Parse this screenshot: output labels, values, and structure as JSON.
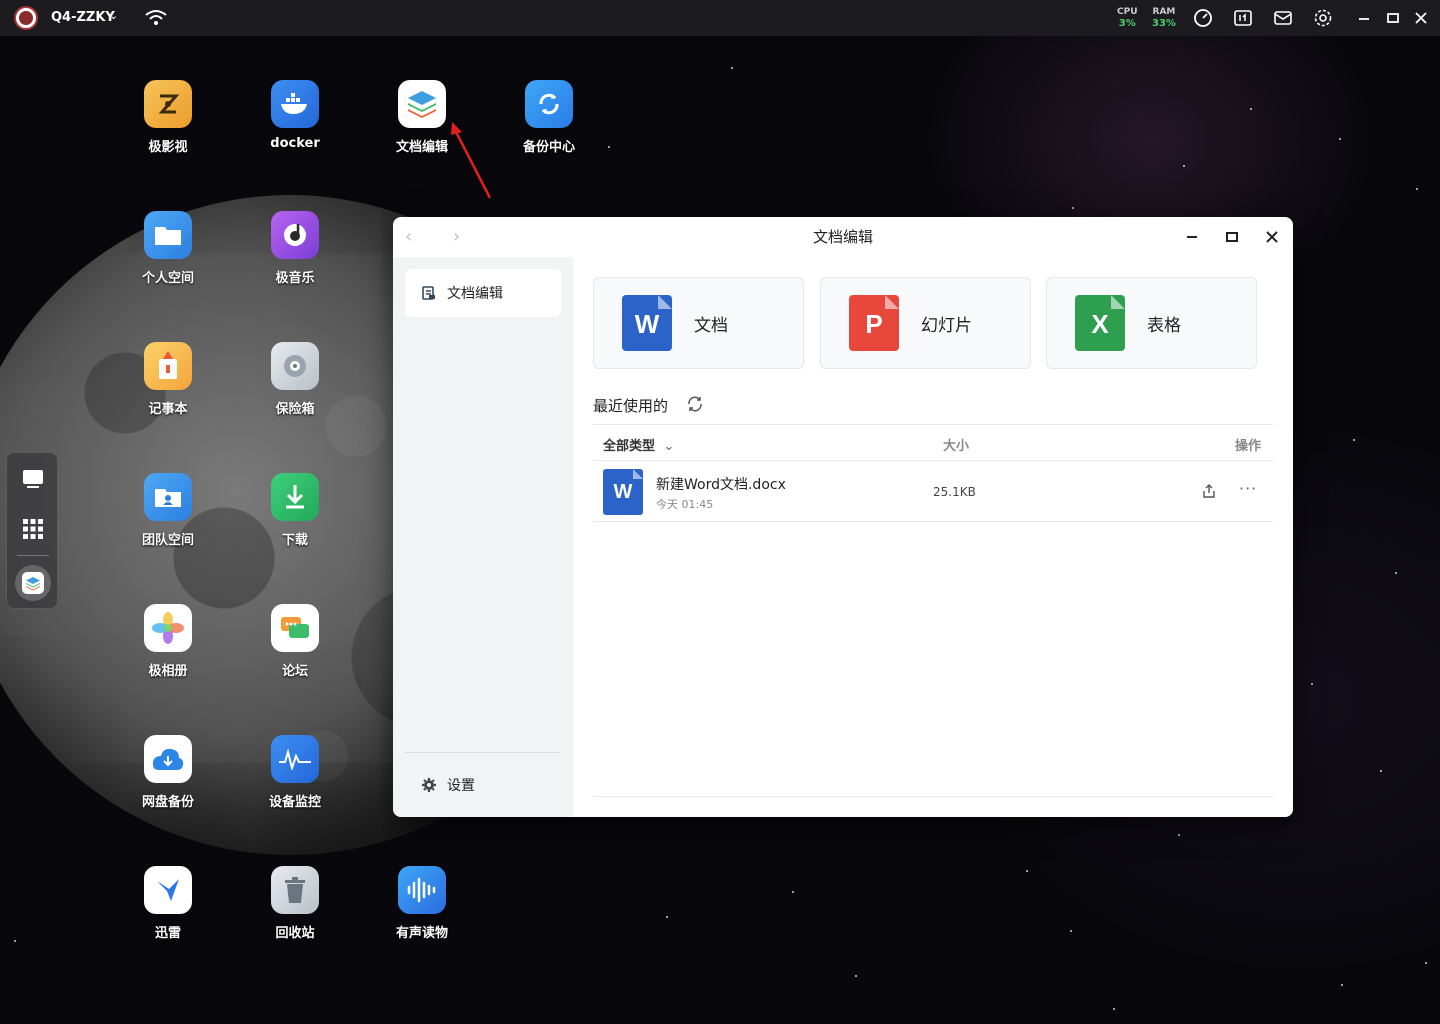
{
  "topbar": {
    "device_name": "Q4-ZZKY",
    "cpu_label": "CPU",
    "cpu_value": "3%",
    "ram_label": "RAM",
    "ram_value": "33%"
  },
  "desktop_icons": [
    {
      "label": "极影视",
      "icon": "film-icon"
    },
    {
      "label": "docker",
      "icon": "docker-icon"
    },
    {
      "label": "文档编辑",
      "icon": "layers-icon"
    },
    {
      "label": "备份中心",
      "icon": "sync-icon"
    },
    {
      "label": "个人空间",
      "icon": "folder-icon"
    },
    {
      "label": "极音乐",
      "icon": "music-icon"
    },
    {
      "label": "记事本",
      "icon": "notepad-icon"
    },
    {
      "label": "保险箱",
      "icon": "safe-icon"
    },
    {
      "label": "团队空间",
      "icon": "team-folder-icon"
    },
    {
      "label": "下载",
      "icon": "download-icon"
    },
    {
      "label": "极相册",
      "icon": "photos-icon"
    },
    {
      "label": "论坛",
      "icon": "forum-icon"
    },
    {
      "label": "网盘备份",
      "icon": "cloud-download-icon"
    },
    {
      "label": "设备监控",
      "icon": "monitor-wave-icon"
    },
    {
      "label": "迅雷",
      "icon": "thunder-icon"
    },
    {
      "label": "回收站",
      "icon": "trash-icon"
    },
    {
      "label": "有声读物",
      "icon": "audio-wave-icon"
    }
  ],
  "window": {
    "title": "文档编辑",
    "sidebar": {
      "active_item": "文档编辑",
      "settings_label": "设置"
    },
    "cards": [
      {
        "letter": "W",
        "label": "文档",
        "color": "#2b63c9"
      },
      {
        "letter": "P",
        "label": "幻灯片",
        "color": "#e8473b"
      },
      {
        "letter": "X",
        "label": "表格",
        "color": "#2e9e4f"
      }
    ],
    "recent_title": "最近使用的",
    "table": {
      "col_type": "全部类型",
      "col_size": "大小",
      "col_action": "操作"
    },
    "files": [
      {
        "name": "新建Word文档.docx",
        "date": "今天 01:45",
        "size": "25.1KB",
        "letter": "W"
      }
    ]
  },
  "colors": {
    "word": "#2b63c9",
    "ppt": "#e8473b",
    "excel": "#2e9e4f",
    "stat_green": "#4ccf6f"
  }
}
